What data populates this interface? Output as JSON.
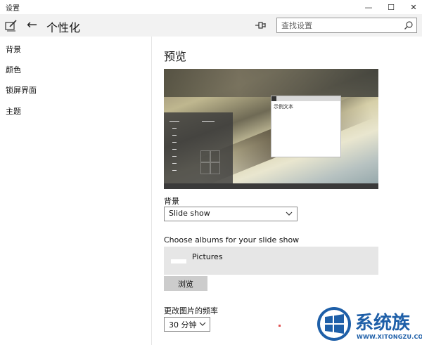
{
  "window": {
    "app_title": "设置",
    "controls": {
      "minimize": "—",
      "maximize": "☐",
      "close": "✕"
    }
  },
  "header": {
    "back_glyph": "←",
    "page_title": "个性化",
    "search_placeholder": "查找设置"
  },
  "icons": {
    "edit": "edit-icon",
    "back": "back-arrow-icon",
    "pin": "pin-icon",
    "search": "search-icon",
    "chevron": "chevron-down-icon"
  },
  "sidebar": {
    "items": [
      {
        "label": "背景"
      },
      {
        "label": "颜色"
      },
      {
        "label": "锁屏界面"
      },
      {
        "label": "主题"
      }
    ]
  },
  "main": {
    "section_title": "预览",
    "preview": {
      "sample_text": "示例文本"
    },
    "background": {
      "label": "背景",
      "selected": "Slide show"
    },
    "albums": {
      "label": "Choose albums for your slide show",
      "items": [
        {
          "name": "Pictures"
        }
      ],
      "browse_label": "浏览"
    },
    "frequency": {
      "label": "更改图片的频率",
      "selected": "30 分钟"
    }
  },
  "watermark": {
    "title": "系统族",
    "subtitle": "WWW.XITONGZU.COM"
  },
  "colors": {
    "accent": "#1e5fa8",
    "header_bg": "#f2f2f2",
    "album_bg": "#e6e6e6",
    "button_bg": "#cccccc"
  }
}
